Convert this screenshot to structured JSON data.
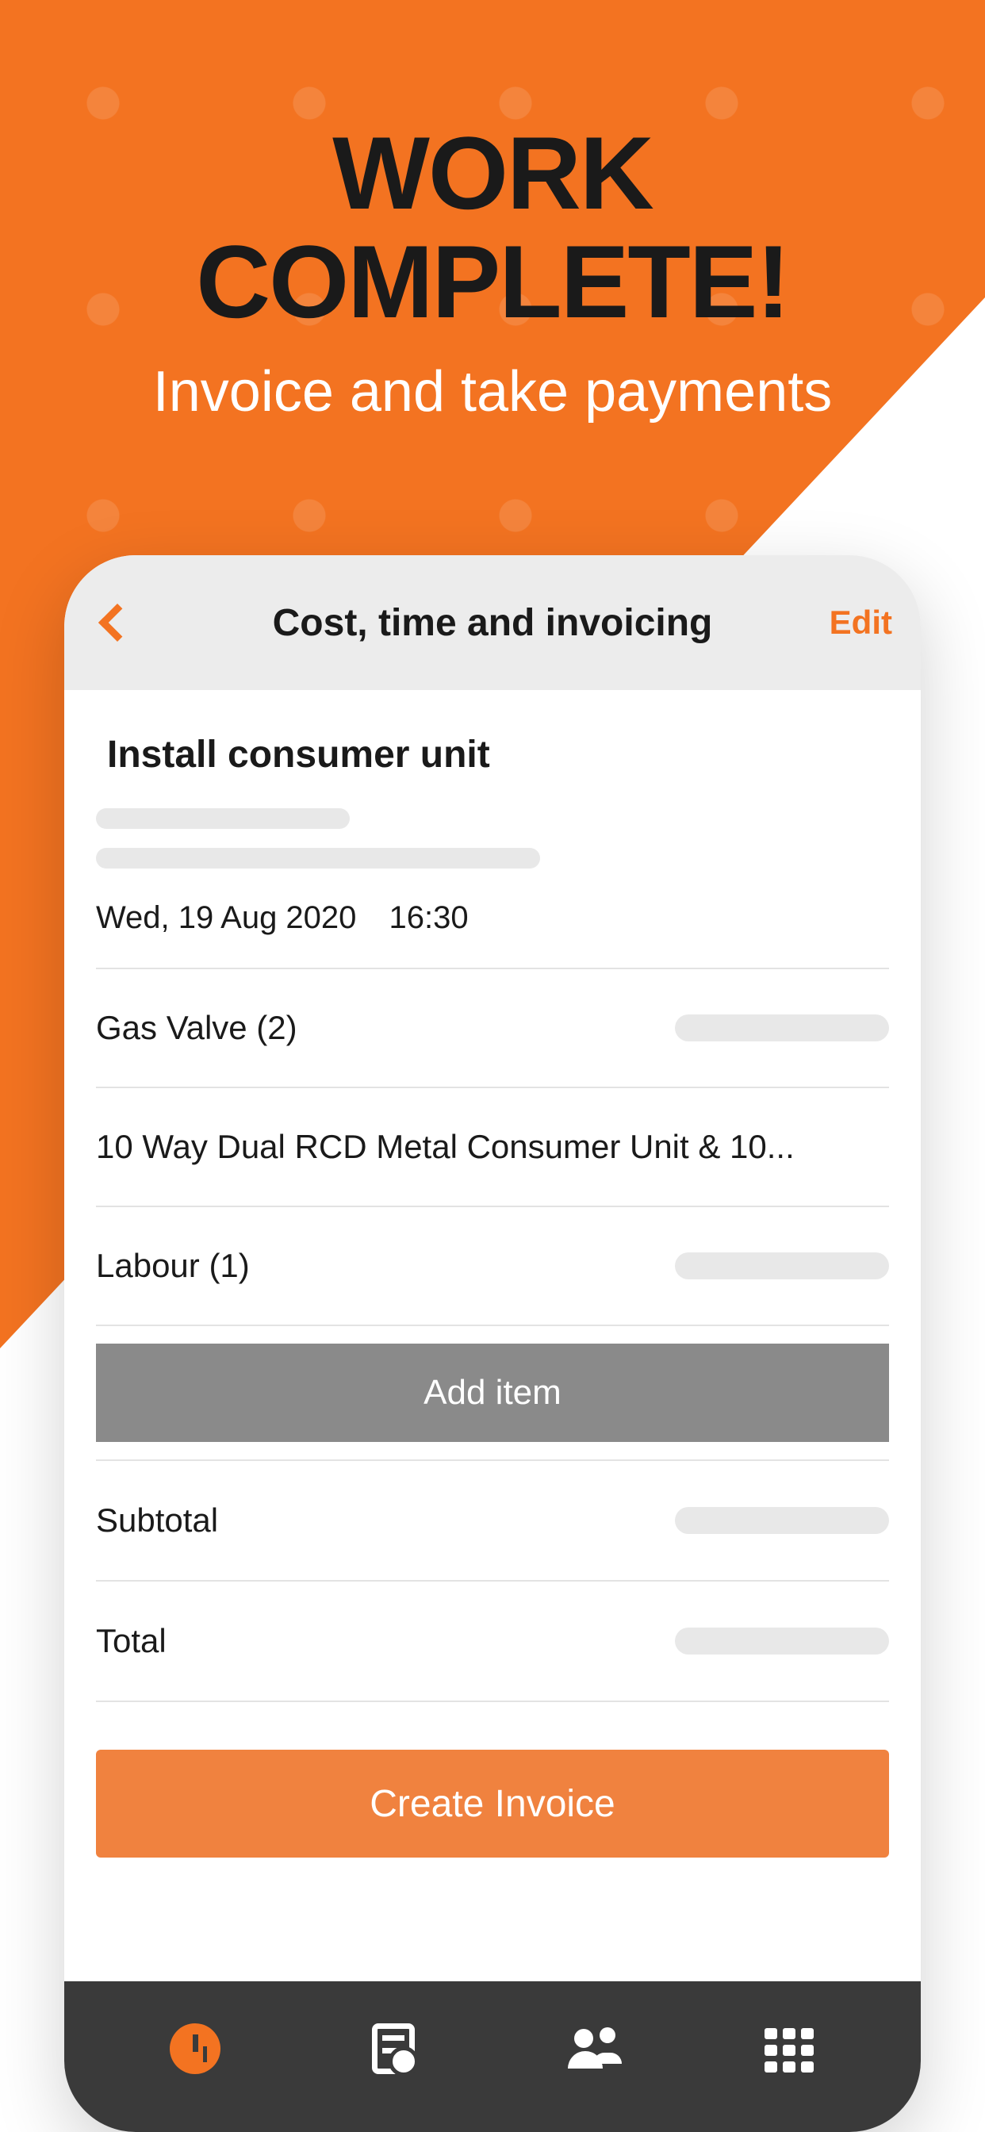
{
  "hero": {
    "title_line1": "WORK",
    "title_line2": "COMPLETE!",
    "subtitle": "Invoice and take payments"
  },
  "header": {
    "title": "Cost, time and invoicing",
    "edit_label": "Edit"
  },
  "job": {
    "title": "Install consumer unit",
    "date": "Wed, 19 Aug 2020",
    "time": "16:30"
  },
  "line_items": [
    {
      "label": "Gas Valve (2)",
      "has_amount_placeholder": true
    },
    {
      "label": "10 Way Dual RCD Metal Consumer Unit & 10...",
      "has_amount_placeholder": false
    },
    {
      "label": "Labour (1)",
      "has_amount_placeholder": true
    }
  ],
  "buttons": {
    "add_item": "Add item",
    "create_invoice": "Create Invoice"
  },
  "summary": {
    "subtotal_label": "Subtotal",
    "total_label": "Total"
  }
}
